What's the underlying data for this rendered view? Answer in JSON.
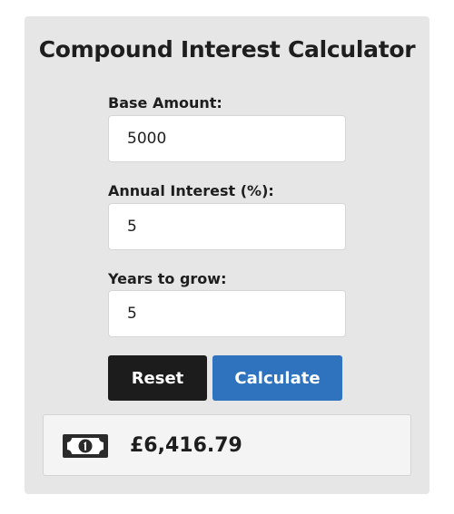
{
  "calculator": {
    "title": "Compound Interest Calculator",
    "fields": {
      "base_amount": {
        "label": "Base Amount:",
        "value": "5000"
      },
      "annual_interest": {
        "label": "Annual Interest (%):",
        "value": "5"
      },
      "years": {
        "label": "Years to grow:",
        "value": "5"
      }
    },
    "buttons": {
      "reset_label": "Reset",
      "calculate_label": "Calculate"
    },
    "result": {
      "icon": "money-bill-icon",
      "value": "£6,416.79"
    }
  },
  "colors": {
    "card_background": "#e6e6e6",
    "reset_button": "#1c1c1c",
    "calculate_button": "#2f72bd",
    "result_background": "#f4f4f4"
  }
}
